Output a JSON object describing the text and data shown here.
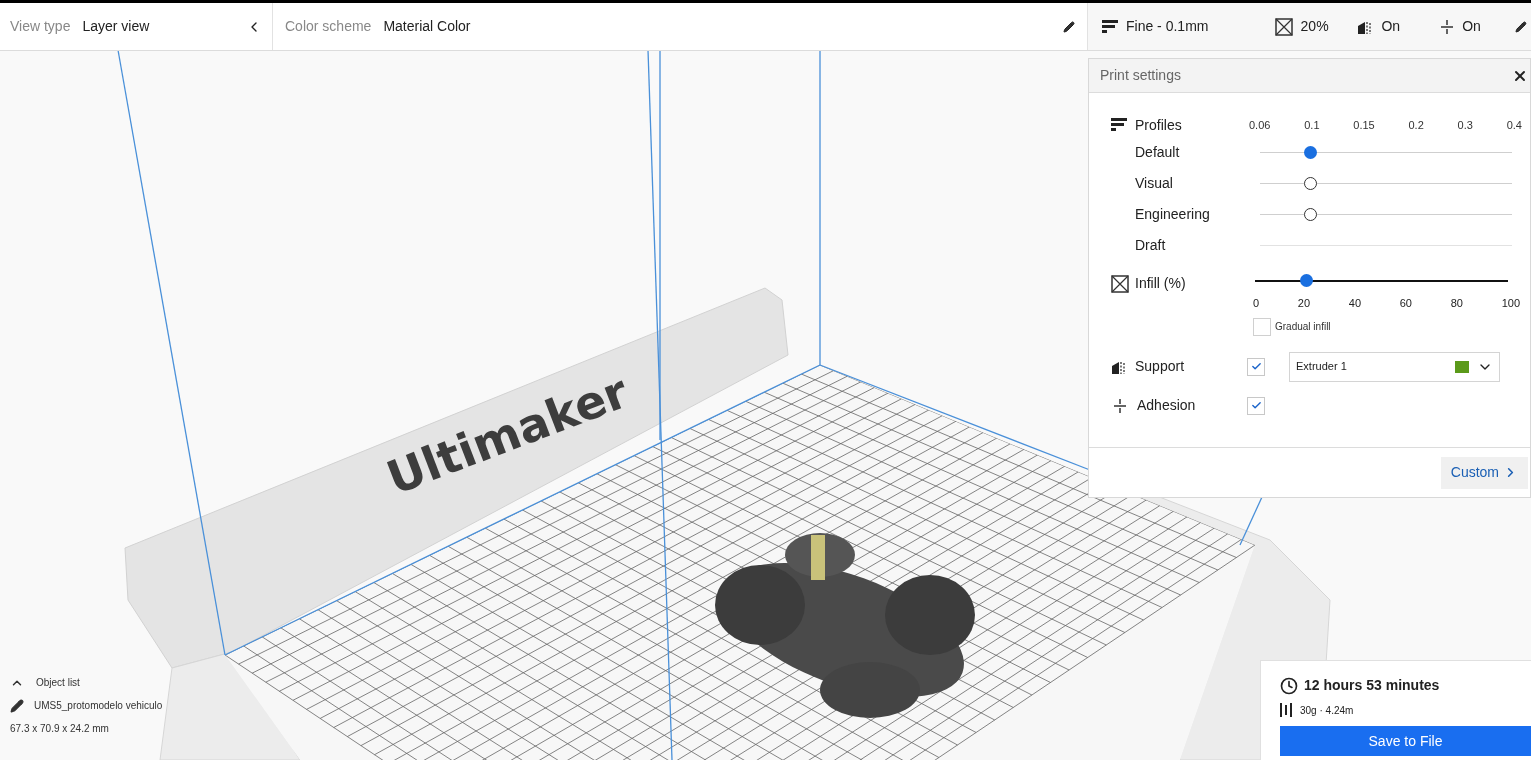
{
  "top_bar": {
    "view_type": {
      "label": "View type",
      "value": "Layer view"
    },
    "color_scheme": {
      "label": "Color scheme",
      "value": "Material Color"
    },
    "print_summary": {
      "profile": "Fine - 0.1mm",
      "infill": "20%",
      "support": "On",
      "adhesion": "On"
    }
  },
  "viewport": {
    "brand_text": "Ultimaker"
  },
  "print_settings": {
    "title": "Print settings",
    "profiles": {
      "label": "Profiles",
      "ticks": [
        "0.06",
        "0.1",
        "0.15",
        "0.2",
        "0.3",
        "0.4"
      ],
      "rows": [
        {
          "name": "Default",
          "kind": "active",
          "level": 0.2
        },
        {
          "name": "Visual",
          "kind": "option",
          "level": 0.2
        },
        {
          "name": "Engineering",
          "kind": "option",
          "level": 0.2
        },
        {
          "name": "Draft",
          "kind": "unavailable"
        }
      ]
    },
    "infill": {
      "label": "Infill (%)",
      "level": 0.2,
      "ticks": [
        "0",
        "20",
        "40",
        "60",
        "80",
        "100"
      ],
      "gradual": {
        "label": "Gradual infill",
        "checked": false
      }
    },
    "support": {
      "label": "Support",
      "checked": true,
      "extruder": {
        "name": "Extruder 1",
        "color": "#5b9a1a"
      }
    },
    "adhesion": {
      "label": "Adhesion",
      "checked": true
    },
    "custom_button": "Custom"
  },
  "object_list": {
    "title": "Object list",
    "object": "UMS5_protomodelo vehiculo",
    "dimensions": "67.3 x 70.9 x 24.2 mm"
  },
  "estimate": {
    "time": "12 hours 53 minutes",
    "material": "30g · 4.24m",
    "action": "Save to File"
  }
}
